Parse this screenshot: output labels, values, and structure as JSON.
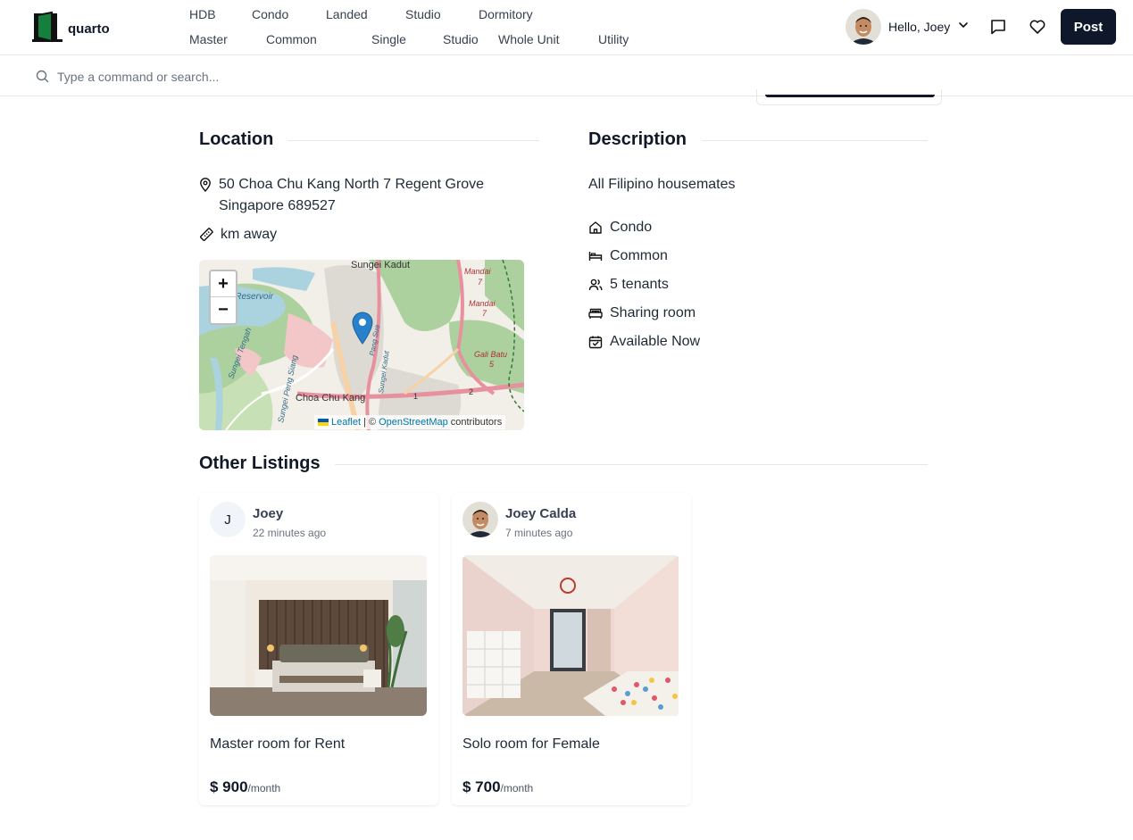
{
  "header": {
    "logo_text": "quarto",
    "nav_types": [
      "HDB",
      "Condo",
      "Landed",
      "Studio",
      "Dormitory"
    ],
    "nav_rooms": [
      "Master",
      "Common",
      "Single",
      "Studio",
      "Whole Unit",
      "Utility"
    ],
    "greeting": "Hello, Joey",
    "post_label": "Post"
  },
  "command_bar": {
    "placeholder": "Type a command or search..."
  },
  "location": {
    "heading": "Location",
    "address_line1": "50 Choa Chu Kang North 7 Regent Grove",
    "address_line2": "Singapore 689527",
    "distance": "km away"
  },
  "map": {
    "labels": {
      "sungei_kadut": "Sungei Kadut",
      "reservoir": "ji Reservoir",
      "mandai_top": "Mandai",
      "mandai_top_num": "7",
      "mandai_mid": "Mandai",
      "mandai_mid_num": "7",
      "gali_batu": "Gali Batu",
      "gali_batu_num": "5",
      "sungei_tengah": "Sungei Tengah",
      "sungei_peng_siang": "Sungei Peng Siang",
      "pang_sua": "Pang Sua",
      "kadut_canal": "Sungei Kadut",
      "choa_chu_kang": "Choa Chu Kang",
      "route_1": "1",
      "route_2": "2"
    },
    "zoom_in": "+",
    "zoom_out": "−",
    "attribution_leaflet": "Leaflet",
    "attribution_sep": "| ©",
    "attribution_osm": "OpenStreetMap",
    "attribution_contrib": "contributors"
  },
  "description": {
    "heading": "Description",
    "text": "All Filipino housemates",
    "property_type": "Condo",
    "room_type": "Common",
    "tenants": "5 tenants",
    "room_sharing": "Sharing room",
    "availability": "Available Now"
  },
  "other_listings": {
    "heading": "Other Listings",
    "cards": [
      {
        "avatar_letter": "J",
        "owner": "Joey",
        "time": "22 minutes ago",
        "title": "Master room for Rent",
        "price": "$ 900",
        "unit": "/month"
      },
      {
        "owner": "Joey Calda",
        "time": "7 minutes ago",
        "title": "Solo room for Female",
        "price": "$ 700",
        "unit": "/month"
      }
    ]
  },
  "colors": {
    "primary_dark": "#0f172a",
    "logo_green": "#15803d",
    "map_marker": "#2a81cb",
    "map_road": "#e8919e",
    "map_green": "#add19e"
  }
}
